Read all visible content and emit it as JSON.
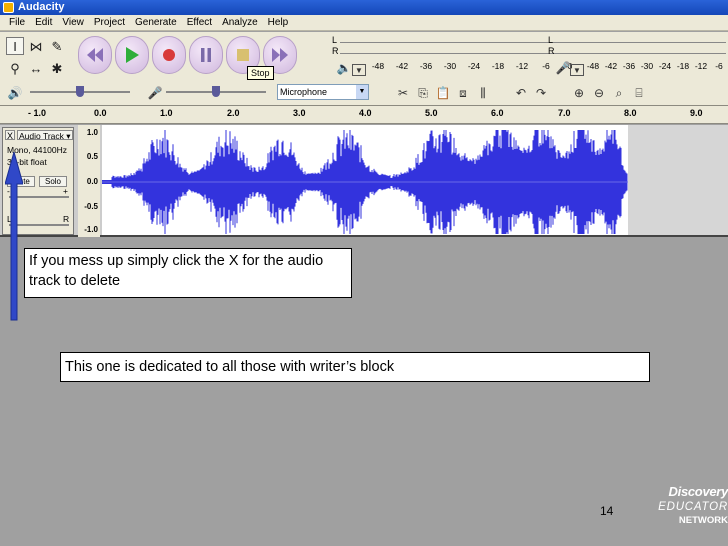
{
  "window": {
    "title": "Audacity"
  },
  "menu": [
    "File",
    "Edit",
    "View",
    "Project",
    "Generate",
    "Effect",
    "Analyze",
    "Help"
  ],
  "tooltip": "Stop",
  "meters": {
    "left_channel": "L",
    "right_channel": "R",
    "output_scale": [
      "-48",
      "-42",
      "-36",
      "-30",
      "-24",
      "-18",
      "-12",
      "-6",
      "0"
    ],
    "input_scale": [
      "-48",
      "-42",
      "-36",
      "-30",
      "-24",
      "-18",
      "-12",
      "-6",
      "0"
    ]
  },
  "mixer": {
    "input_source": "Microphone"
  },
  "ruler": {
    "ticks": [
      "- 1.0",
      "0.0",
      "1.0",
      "2.0",
      "3.0",
      "4.0",
      "5.0",
      "6.0",
      "7.0",
      "8.0",
      "9.0"
    ]
  },
  "track": {
    "close_label": "X",
    "name": "Audio Track",
    "format_line1": "Mono, 44100Hz",
    "format_line2": "32-bit float",
    "mute_label": "Mute",
    "solo_label": "Solo",
    "pan_left": "L",
    "pan_right": "R",
    "scale": [
      "1.0",
      "0.5",
      "0.0",
      "-0.5",
      "-1.0"
    ]
  },
  "callouts": {
    "delete_tip": "If you mess up simply click the X for the audio track to delete",
    "dedication": "This one is dedicated to all those with writer’s block"
  },
  "slide_number": "14",
  "logo": {
    "line1": "Discovery",
    "line2": "EDUCATOR",
    "line3": "NETWORK"
  },
  "colors": {
    "waveform": "#3333dd",
    "titlebar": "#1e55c8",
    "annotation_arrow": "#3048c8"
  }
}
